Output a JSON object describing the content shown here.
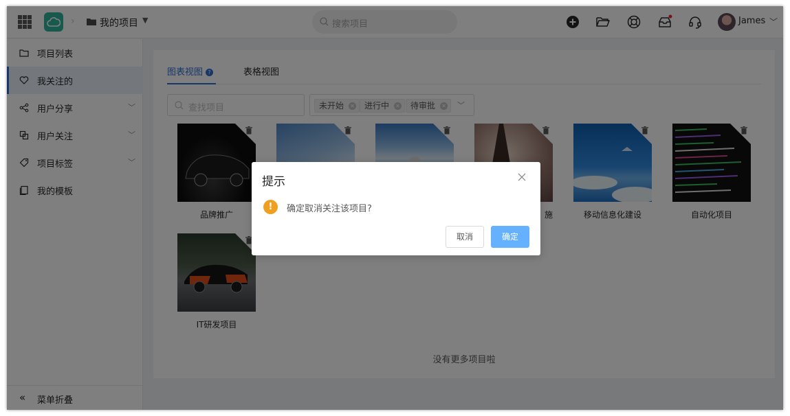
{
  "header": {
    "project_title": "我的项目",
    "search_placeholder": "搜索项目",
    "user_name": "James",
    "has_notification": true,
    "icons": [
      "apps-grid-icon",
      "cloud-logo",
      "chevron-right-icon",
      "folder-icon",
      "plus-circle-icon",
      "folder-open-icon",
      "help-ring-icon",
      "inbox-icon",
      "headset-icon",
      "chevron-down-icon"
    ]
  },
  "sidebar": {
    "items": [
      {
        "label": "项目列表",
        "icon": "folder-icon",
        "active": false,
        "expandable": false
      },
      {
        "label": "我关注的",
        "icon": "heart-icon",
        "active": true,
        "expandable": false
      },
      {
        "label": "用户分享",
        "icon": "share-icon",
        "active": false,
        "expandable": true
      },
      {
        "label": "用户关注",
        "icon": "copy-icon",
        "active": false,
        "expandable": true
      },
      {
        "label": "项目标签",
        "icon": "tag-icon",
        "active": false,
        "expandable": true
      },
      {
        "label": "我的模板",
        "icon": "document-icon",
        "active": false,
        "expandable": false
      }
    ],
    "collapse_label": "菜单折叠"
  },
  "main": {
    "tabs": [
      {
        "label": "图表视图",
        "active": true
      },
      {
        "label": "表格视图",
        "active": false
      }
    ],
    "search_placeholder": "查找项目",
    "status_tags": [
      "未开始",
      "进行中",
      "待审批"
    ],
    "projects": [
      {
        "name": "品牌推广",
        "image": "black-sports-car"
      },
      {
        "name": "",
        "image": "blue-sky-clouds"
      },
      {
        "name": "",
        "image": "pier-over-sea"
      },
      {
        "name": "施",
        "image": "eiffel-tower-model"
      },
      {
        "name": "移动信息化建设",
        "image": "snowy-blue-landscape"
      },
      {
        "name": "自动化项目",
        "image": "code-screen"
      },
      {
        "name": "IT研发项目",
        "image": "black-orange-supercar"
      }
    ],
    "footer_text": "没有更多项目啦"
  },
  "dialog": {
    "title": "提示",
    "message": "确定取消关注该项目?",
    "cancel_label": "取消",
    "confirm_label": "确定",
    "icon": "warning-icon"
  },
  "colors": {
    "accent": "#2f6fd6",
    "confirm_button": "#66b1ff",
    "warning": "#f0a020",
    "logo": "#2fb59b",
    "notification_dot": "#f5222d"
  }
}
